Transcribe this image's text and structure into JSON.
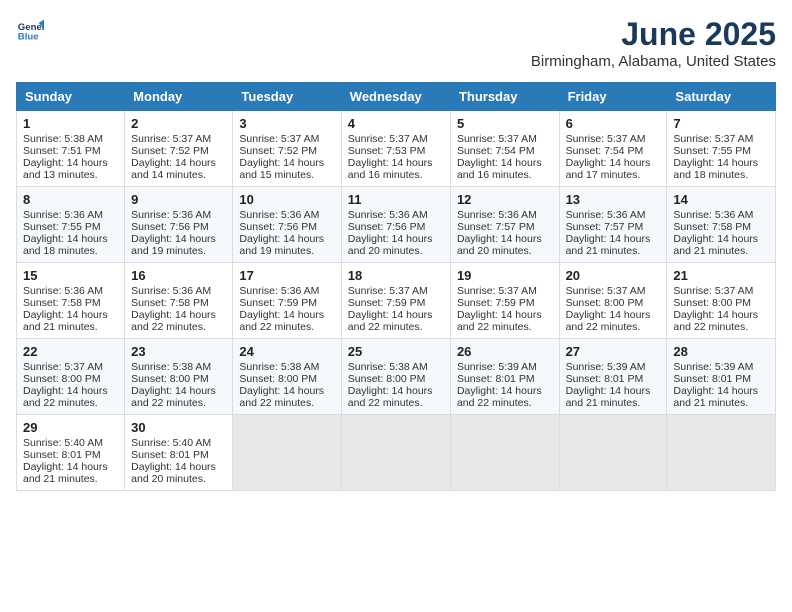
{
  "header": {
    "logo_line1": "General",
    "logo_line2": "Blue",
    "month": "June 2025",
    "location": "Birmingham, Alabama, United States"
  },
  "days_of_week": [
    "Sunday",
    "Monday",
    "Tuesday",
    "Wednesday",
    "Thursday",
    "Friday",
    "Saturday"
  ],
  "weeks": [
    [
      {
        "day": "1",
        "lines": [
          "Sunrise: 5:38 AM",
          "Sunset: 7:51 PM",
          "Daylight: 14 hours",
          "and 13 minutes."
        ]
      },
      {
        "day": "2",
        "lines": [
          "Sunrise: 5:37 AM",
          "Sunset: 7:52 PM",
          "Daylight: 14 hours",
          "and 14 minutes."
        ]
      },
      {
        "day": "3",
        "lines": [
          "Sunrise: 5:37 AM",
          "Sunset: 7:52 PM",
          "Daylight: 14 hours",
          "and 15 minutes."
        ]
      },
      {
        "day": "4",
        "lines": [
          "Sunrise: 5:37 AM",
          "Sunset: 7:53 PM",
          "Daylight: 14 hours",
          "and 16 minutes."
        ]
      },
      {
        "day": "5",
        "lines": [
          "Sunrise: 5:37 AM",
          "Sunset: 7:54 PM",
          "Daylight: 14 hours",
          "and 16 minutes."
        ]
      },
      {
        "day": "6",
        "lines": [
          "Sunrise: 5:37 AM",
          "Sunset: 7:54 PM",
          "Daylight: 14 hours",
          "and 17 minutes."
        ]
      },
      {
        "day": "7",
        "lines": [
          "Sunrise: 5:37 AM",
          "Sunset: 7:55 PM",
          "Daylight: 14 hours",
          "and 18 minutes."
        ]
      }
    ],
    [
      {
        "day": "8",
        "lines": [
          "Sunrise: 5:36 AM",
          "Sunset: 7:55 PM",
          "Daylight: 14 hours",
          "and 18 minutes."
        ]
      },
      {
        "day": "9",
        "lines": [
          "Sunrise: 5:36 AM",
          "Sunset: 7:56 PM",
          "Daylight: 14 hours",
          "and 19 minutes."
        ]
      },
      {
        "day": "10",
        "lines": [
          "Sunrise: 5:36 AM",
          "Sunset: 7:56 PM",
          "Daylight: 14 hours",
          "and 19 minutes."
        ]
      },
      {
        "day": "11",
        "lines": [
          "Sunrise: 5:36 AM",
          "Sunset: 7:56 PM",
          "Daylight: 14 hours",
          "and 20 minutes."
        ]
      },
      {
        "day": "12",
        "lines": [
          "Sunrise: 5:36 AM",
          "Sunset: 7:57 PM",
          "Daylight: 14 hours",
          "and 20 minutes."
        ]
      },
      {
        "day": "13",
        "lines": [
          "Sunrise: 5:36 AM",
          "Sunset: 7:57 PM",
          "Daylight: 14 hours",
          "and 21 minutes."
        ]
      },
      {
        "day": "14",
        "lines": [
          "Sunrise: 5:36 AM",
          "Sunset: 7:58 PM",
          "Daylight: 14 hours",
          "and 21 minutes."
        ]
      }
    ],
    [
      {
        "day": "15",
        "lines": [
          "Sunrise: 5:36 AM",
          "Sunset: 7:58 PM",
          "Daylight: 14 hours",
          "and 21 minutes."
        ]
      },
      {
        "day": "16",
        "lines": [
          "Sunrise: 5:36 AM",
          "Sunset: 7:58 PM",
          "Daylight: 14 hours",
          "and 22 minutes."
        ]
      },
      {
        "day": "17",
        "lines": [
          "Sunrise: 5:36 AM",
          "Sunset: 7:59 PM",
          "Daylight: 14 hours",
          "and 22 minutes."
        ]
      },
      {
        "day": "18",
        "lines": [
          "Sunrise: 5:37 AM",
          "Sunset: 7:59 PM",
          "Daylight: 14 hours",
          "and 22 minutes."
        ]
      },
      {
        "day": "19",
        "lines": [
          "Sunrise: 5:37 AM",
          "Sunset: 7:59 PM",
          "Daylight: 14 hours",
          "and 22 minutes."
        ]
      },
      {
        "day": "20",
        "lines": [
          "Sunrise: 5:37 AM",
          "Sunset: 8:00 PM",
          "Daylight: 14 hours",
          "and 22 minutes."
        ]
      },
      {
        "day": "21",
        "lines": [
          "Sunrise: 5:37 AM",
          "Sunset: 8:00 PM",
          "Daylight: 14 hours",
          "and 22 minutes."
        ]
      }
    ],
    [
      {
        "day": "22",
        "lines": [
          "Sunrise: 5:37 AM",
          "Sunset: 8:00 PM",
          "Daylight: 14 hours",
          "and 22 minutes."
        ]
      },
      {
        "day": "23",
        "lines": [
          "Sunrise: 5:38 AM",
          "Sunset: 8:00 PM",
          "Daylight: 14 hours",
          "and 22 minutes."
        ]
      },
      {
        "day": "24",
        "lines": [
          "Sunrise: 5:38 AM",
          "Sunset: 8:00 PM",
          "Daylight: 14 hours",
          "and 22 minutes."
        ]
      },
      {
        "day": "25",
        "lines": [
          "Sunrise: 5:38 AM",
          "Sunset: 8:00 PM",
          "Daylight: 14 hours",
          "and 22 minutes."
        ]
      },
      {
        "day": "26",
        "lines": [
          "Sunrise: 5:39 AM",
          "Sunset: 8:01 PM",
          "Daylight: 14 hours",
          "and 22 minutes."
        ]
      },
      {
        "day": "27",
        "lines": [
          "Sunrise: 5:39 AM",
          "Sunset: 8:01 PM",
          "Daylight: 14 hours",
          "and 21 minutes."
        ]
      },
      {
        "day": "28",
        "lines": [
          "Sunrise: 5:39 AM",
          "Sunset: 8:01 PM",
          "Daylight: 14 hours",
          "and 21 minutes."
        ]
      }
    ],
    [
      {
        "day": "29",
        "lines": [
          "Sunrise: 5:40 AM",
          "Sunset: 8:01 PM",
          "Daylight: 14 hours",
          "and 21 minutes."
        ]
      },
      {
        "day": "30",
        "lines": [
          "Sunrise: 5:40 AM",
          "Sunset: 8:01 PM",
          "Daylight: 14 hours",
          "and 20 minutes."
        ]
      },
      {
        "day": "",
        "lines": []
      },
      {
        "day": "",
        "lines": []
      },
      {
        "day": "",
        "lines": []
      },
      {
        "day": "",
        "lines": []
      },
      {
        "day": "",
        "lines": []
      }
    ]
  ]
}
